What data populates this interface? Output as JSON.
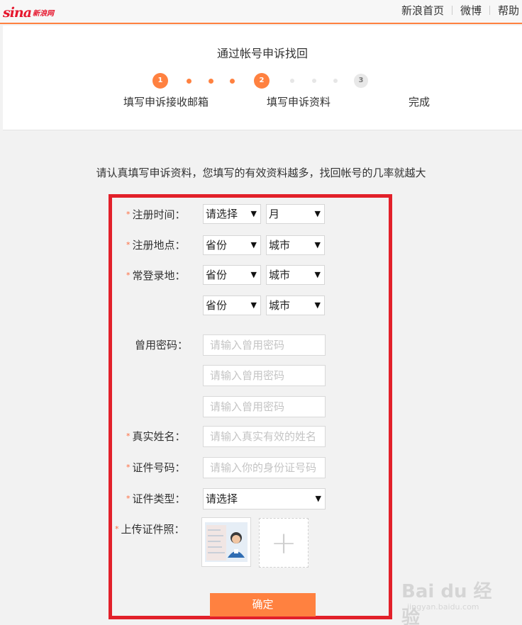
{
  "topbar": {
    "logo_text": "sina",
    "logo_cn": "新浪网",
    "links": [
      "新浪首页",
      "微博",
      "帮助"
    ]
  },
  "header": {
    "title": "通过帐号申诉找回",
    "steps": [
      {
        "number": "1",
        "label": "填写申诉接收邮箱",
        "state": "active"
      },
      {
        "number": "2",
        "label": "填写申诉资料",
        "state": "active"
      },
      {
        "number": "3",
        "label": "完成",
        "state": "inactive"
      }
    ]
  },
  "form": {
    "intro": "请认真填写申诉资料，您填写的有效资料越多，找回帐号的几率就越大",
    "reg_time_label": "注册时间：",
    "reg_time_year": "请选择",
    "reg_time_month": "月",
    "reg_place_label": "注册地点：",
    "reg_place_province": "省份",
    "reg_place_city": "城市",
    "login_place_label": "常登录地：",
    "login_place_1_province": "省份",
    "login_place_1_city": "城市",
    "login_place_2_province": "省份",
    "login_place_2_city": "城市",
    "old_pwd_label": "曾用密码：",
    "old_pwd_placeholder": "请输入曾用密码",
    "real_name_label": "真实姓名：",
    "real_name_placeholder": "请输入真实有效的姓名",
    "id_number_label": "证件号码：",
    "id_number_placeholder": "请输入你的身份证号码",
    "id_type_label": "证件类型：",
    "id_type_value": "请选择",
    "upload_label": "上传证件照：",
    "required_mark": "*",
    "add_symbol": "+",
    "confirm_label": "确定"
  },
  "watermark": {
    "text": "Bai du 经验",
    "sub": "jingyan.baidu.com"
  },
  "colors": {
    "accent": "#ff8140",
    "frame": "#e2202a",
    "logo": "#e6162d"
  }
}
